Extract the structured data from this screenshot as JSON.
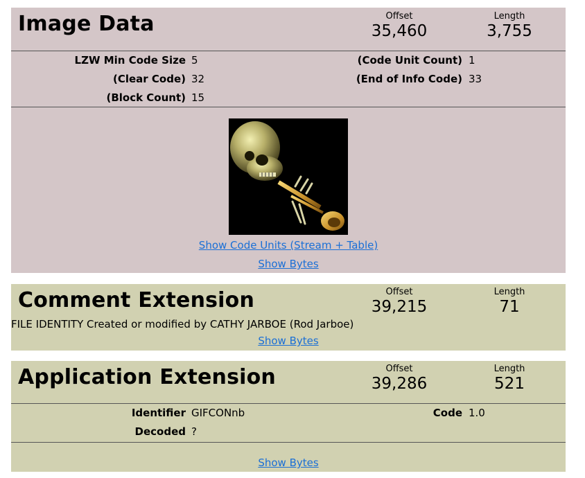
{
  "image_data": {
    "title": "Image Data",
    "offset_label": "Offset",
    "offset_value": "35,460",
    "length_label": "Length",
    "length_value": "3,755",
    "fields": {
      "lzw_min_code_size_label": "LZW Min Code Size",
      "lzw_min_code_size_value": "5",
      "clear_code_label": "(Clear Code)",
      "clear_code_value": "32",
      "block_count_label": "(Block Count)",
      "block_count_value": "15",
      "code_unit_count_label": "(Code Unit Count)",
      "code_unit_count_value": "1",
      "end_of_info_code_label": "(End of Info Code)",
      "end_of_info_code_value": "33"
    },
    "show_code_units_link": "Show Code Units (Stream + Table)",
    "show_bytes_link": "Show Bytes"
  },
  "comment_extension": {
    "title": "Comment Extension",
    "offset_label": "Offset",
    "offset_value": "39,215",
    "length_label": "Length",
    "length_value": "71",
    "text": "FILE IDENTITY Created or modified by CATHY JARBOE (Rod Jarboe)",
    "show_bytes_link": "Show Bytes"
  },
  "application_extension": {
    "title": "Application Extension",
    "offset_label": "Offset",
    "offset_value": "39,286",
    "length_label": "Length",
    "length_value": "521",
    "identifier_label": "Identifier",
    "identifier_value": "GIFCONnb",
    "code_label": "Code",
    "code_value": "1.0",
    "decoded_label": "Decoded",
    "decoded_value": "?",
    "show_bytes_link": "Show Bytes"
  },
  "colors": {
    "image_block_bg": "#d4c6c8",
    "extension_block_bg": "#d1d1b1",
    "link": "#1a6fd6"
  }
}
